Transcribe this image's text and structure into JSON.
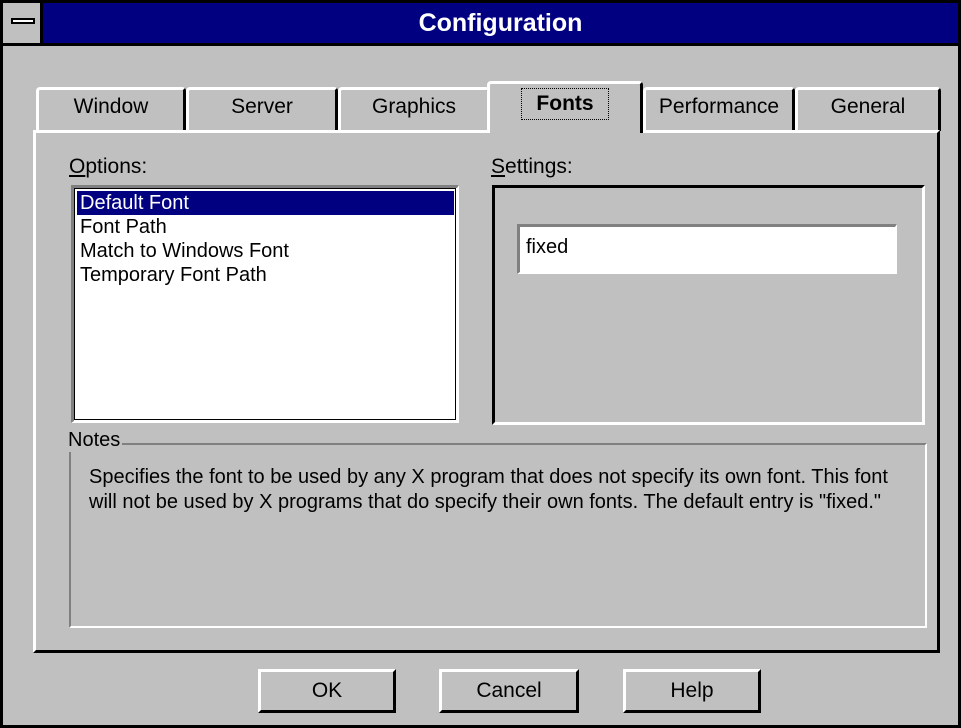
{
  "window": {
    "title": "Configuration"
  },
  "tabs": [
    {
      "label": "Window"
    },
    {
      "label": "Server"
    },
    {
      "label": "Graphics"
    },
    {
      "label": "Fonts",
      "active": true
    },
    {
      "label": "Performance"
    },
    {
      "label": "General"
    }
  ],
  "options": {
    "label_mnemonic": "O",
    "label_rest": "ptions:",
    "items": [
      {
        "label": "Default Font",
        "selected": true
      },
      {
        "label": "Font Path"
      },
      {
        "label": "Match to Windows Font"
      },
      {
        "label": "Temporary Font Path"
      }
    ]
  },
  "settings": {
    "label_mnemonic": "S",
    "label_rest": "ettings:",
    "value": "fixed"
  },
  "notes": {
    "legend": "Notes",
    "text": "Specifies the font to be used by any X program that does not specify its own font. This font will not be used by X programs that do specify their own fonts. The default entry is \"fixed.\""
  },
  "buttons": {
    "ok": "OK",
    "cancel": "Cancel",
    "help": "Help"
  },
  "colors": {
    "titlebar": "#000080",
    "face": "#c0c0c0",
    "selection": "#000080"
  }
}
